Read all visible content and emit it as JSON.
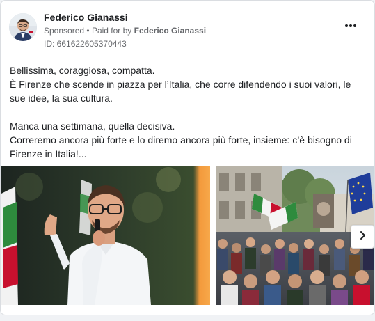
{
  "post": {
    "page_name": "Federico Gianassi",
    "sponsored_label": "Sponsored",
    "separator": "•",
    "paid_for_label": "Paid for by",
    "paid_for_name": "Federico Gianassi",
    "ad_id": "ID: 661622605370443",
    "more_icon": "more-horizontal-icon",
    "text": {
      "line1": "Bellissima, coraggiosa, compatta.",
      "line2": "È Firenze che scende in piazza per l’Italia, che corre difendendo i suoi valori, le sue idee, la sua cultura.",
      "line3": "Manca una settimana, quella decisiva.",
      "line4": "Correremo ancora più forte e lo diremo ancora più forte, insieme: c’è bisogno di Firenze in Italia!..."
    }
  },
  "carousel": {
    "images": [
      {
        "alt": "Man with glasses and white shirt speaking into a microphone on stage"
      },
      {
        "alt": "Crowd gathered in a street square with flags at dusk"
      }
    ],
    "next_icon": "chevron-right-icon"
  },
  "colors": {
    "name_text": "#1c1e21",
    "meta_text": "#65676b",
    "border": "#dadde1",
    "page_bg": "#f0f2f5"
  }
}
